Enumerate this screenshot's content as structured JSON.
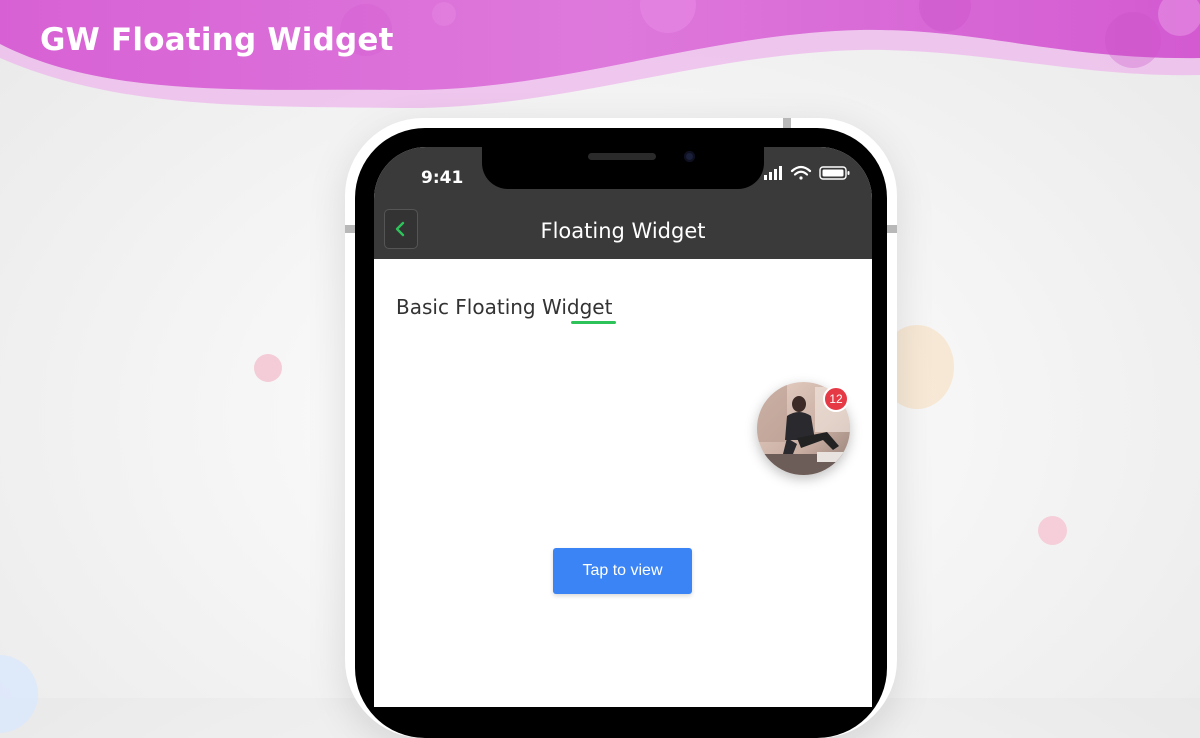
{
  "banner": {
    "title": "GW Floating Widget"
  },
  "colors": {
    "banner_primary": "#d65ad2",
    "banner_secondary": "#e88fe6",
    "appbar": "#3a3a3a",
    "accent_green": "#2ec25a",
    "badge_red": "#e53945",
    "button_blue": "#3a84f5"
  },
  "status_bar": {
    "time": "9:41",
    "icons": [
      "cellular-signal-icon",
      "wifi-icon",
      "battery-icon"
    ]
  },
  "app_bar": {
    "back_icon": "chevron-left-icon",
    "title": "Floating Widget"
  },
  "content": {
    "section_title": "Basic Floating Widget",
    "floating_widget": {
      "badge_count": "12"
    },
    "tap_button_label": "Tap to view"
  }
}
